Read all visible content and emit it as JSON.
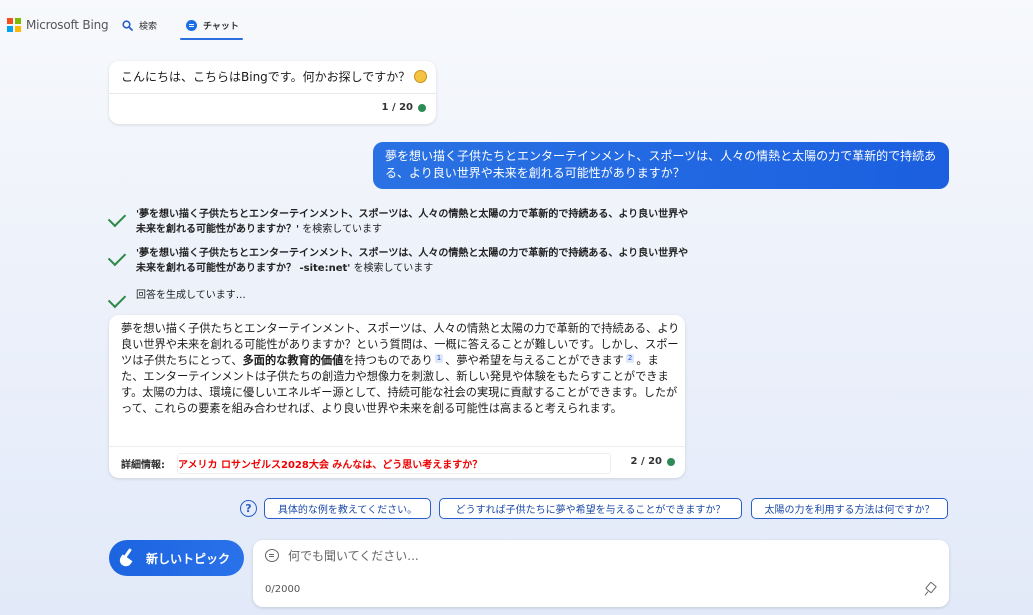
{
  "header": {
    "logo_text": "Microsoft Bing",
    "logo_colors": [
      "#f25022",
      "#7fba00",
      "#00a4ef",
      "#ffb900"
    ],
    "tabs": [
      {
        "label": "検索",
        "icon": "search-icon"
      },
      {
        "label": "チャット",
        "icon": "chat-icon",
        "active": true
      }
    ]
  },
  "greeting": {
    "text": "こんにちは、こちらはBingです。何かお探しですか？",
    "counter": "1 / 20"
  },
  "user_message": {
    "text": "夢を想い描く子供たちとエンターテインメント、スポーツは、人々の情熱と太陽の力で革新的で持続ある、より良い世界や未来を創れる可能性がありますか？"
  },
  "status": [
    {
      "query": "'夢を想い描く子供たちとエンターテインメント、スポーツは、人々の情熱と太陽の力で革新的で持続ある、より良い世界や未来を創れる可能性がありますか？'",
      "suffix": " を検索しています"
    },
    {
      "query": "'夢を想い描く子供たちとエンターテインメント、スポーツは、人々の情熱と太陽の力で革新的で持続ある、より良い世界や未来を創れる可能性がありますか？ -site:net'",
      "suffix": " を検索しています"
    },
    {
      "text": "回答を生成しています…"
    }
  ],
  "answer": {
    "part1": "夢を想い描く子供たちとエンターテインメント、スポーツは、人々の情熱と太陽の力で革新的で持続ある、より良い世界や未来を創れる可能性がありますか？という質問は、一概に答えることが難しいです。しかし、スポーツは子供たちにとって、",
    "bold1": "多面的な教育的価値",
    "part2": "を持つものであり",
    "ref1": "1",
    "part3": "、夢や希望を与えることができます",
    "ref2": "2",
    "part4": "。また、エンターテインメントは子供たちの創造力や想像力を刺激し、新しい発見や体験をもたらすことができます。太陽の力は、環境に優しいエネルギー源として、持続可能な社会の実現に貢献することができます。したがって、これらの要素を組み合わせれば、より良い世界や未来を創る可能性は高まると考えられます。",
    "footer_label": "詳細情報:",
    "footer_link": "アメリカ ロサンゼルス2028大会 みんなは、どう思い考えますか？",
    "counter": "2 / 20"
  },
  "suggestions": [
    "具体的な例を教えてください。",
    "どうすれば子供たちに夢や希望を与えることができますか？",
    "太陽の力を利用する方法は何ですか？"
  ],
  "new_topic_label": "新しいトピック",
  "input": {
    "placeholder": "何でも聞いてください...",
    "value": "",
    "char_count": "0/2000"
  }
}
